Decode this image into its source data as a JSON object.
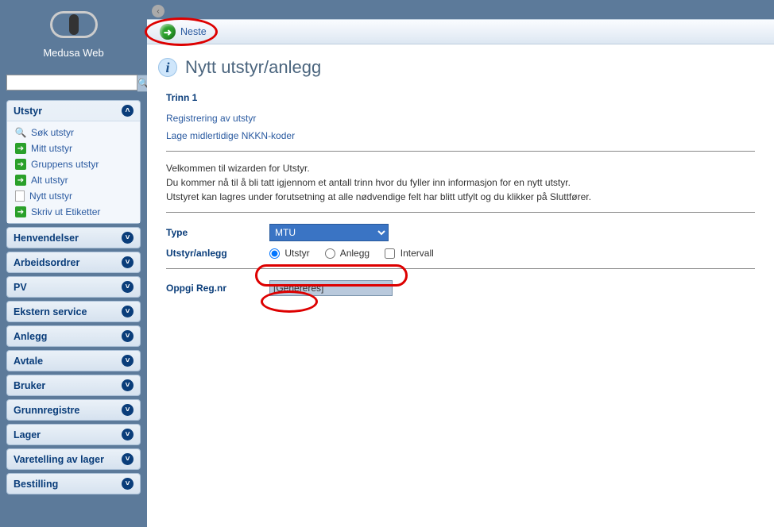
{
  "app": {
    "name": "Medusa Web"
  },
  "search": {
    "value": "",
    "placeholder": ""
  },
  "sidebar": {
    "sections": [
      {
        "label": "Utstyr",
        "expanded": true,
        "items": [
          {
            "label": "Søk utstyr",
            "icon": "search"
          },
          {
            "label": "Mitt utstyr",
            "icon": "arrow"
          },
          {
            "label": "Gruppens utstyr",
            "icon": "arrow"
          },
          {
            "label": "Alt utstyr",
            "icon": "arrow"
          },
          {
            "label": "Nytt utstyr",
            "icon": "doc"
          },
          {
            "label": "Skriv ut Etiketter",
            "icon": "arrow"
          }
        ]
      },
      {
        "label": "Henvendelser",
        "expanded": false
      },
      {
        "label": "Arbeidsordrer",
        "expanded": false
      },
      {
        "label": "PV",
        "expanded": false
      },
      {
        "label": "Ekstern service",
        "expanded": false
      },
      {
        "label": "Anlegg",
        "expanded": false
      },
      {
        "label": "Avtale",
        "expanded": false
      },
      {
        "label": "Bruker",
        "expanded": false
      },
      {
        "label": "Grunnregistre",
        "expanded": false
      },
      {
        "label": "Lager",
        "expanded": false
      },
      {
        "label": "Varetelling av lager",
        "expanded": false
      },
      {
        "label": "Bestilling",
        "expanded": false
      }
    ]
  },
  "toolbar": {
    "next_label": "Neste"
  },
  "page": {
    "title": "Nytt utstyr/anlegg",
    "step_heading": "Trinn 1",
    "link1": "Registrering av utstyr",
    "link2": "Lage midlertidige NKKN-koder",
    "welcome_line1": "Velkommen til wizarden for Utstyr.",
    "welcome_line2": "Du kommer nå til å bli tatt igjennom et antall trinn hvor du fyller inn informasjon for en nytt utstyr.",
    "welcome_line3": "Utstyret kan lagres under forutsetning at alle nødvendige felt har blitt utfylt og du klikker på Sluttfører."
  },
  "form": {
    "type_label": "Type",
    "type_value": "MTU",
    "type_options": [
      "MTU"
    ],
    "ua_label": "Utstyr/anlegg",
    "radio_utstyr": "Utstyr",
    "radio_anlegg": "Anlegg",
    "check_intervall": "Intervall",
    "ua_selected": "Utstyr",
    "intervall_checked": false,
    "reg_label": "Oppgi Reg.nr",
    "reg_value": "[Genereres]"
  }
}
